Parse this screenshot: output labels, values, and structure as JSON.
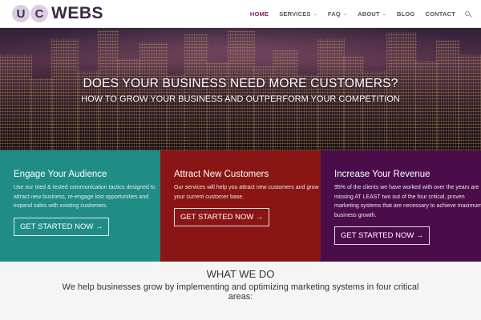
{
  "logo": {
    "letter1": "U",
    "letter2": "C",
    "word": "WEBS"
  },
  "nav": {
    "home": "HOME",
    "services": "SERVICES",
    "faq": "FAQ",
    "about": "ABOUT",
    "blog": "BLOG",
    "contact": "CONTACT",
    "caret": "⌄"
  },
  "hero": {
    "title": "DOES YOUR BUSINESS NEED MORE CUSTOMERS?",
    "subtitle": "HOW TO GROW YOUR BUSINESS AND OUTPERFORM YOUR COMPETITION"
  },
  "features": [
    {
      "title": "Engage Your Audience",
      "text": "Use our tried & tested communication tactics designed to attract new business, re-engage lost opportunities and expand sales with existing customers.",
      "button": "GET STARTED NOW →"
    },
    {
      "title": "Attract New Customers",
      "text": "Our services will help you attract new customers and grow your current customer base.",
      "button": "GET STARTED NOW →"
    },
    {
      "title": "Increase Your Revenue",
      "text": "95% of the clients we have worked with over the years are missing AT LEAST two out of the four critical, proven marketing systems that are necessary to achieve maximum business growth.",
      "button": "GET STARTED NOW →"
    }
  ],
  "what_we_do": {
    "title": "WHAT WE DO",
    "text": "We help businesses grow by implementing and optimizing marketing systems in four critical areas:"
  },
  "colors": {
    "teal": "#1f8c85",
    "red": "#8a1515",
    "purple": "#4a0d4a",
    "nav_active": "#7a1f6a"
  }
}
